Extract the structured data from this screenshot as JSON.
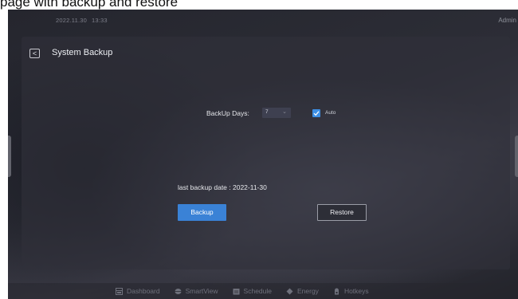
{
  "caption": "page with backup and restore",
  "topbar": {
    "date": "2022.11.30",
    "time": "13:33",
    "user": "Admin"
  },
  "page": {
    "back_icon": "chevron-left-icon",
    "title": "System Backup"
  },
  "backup_settings": {
    "days_label": "BackUp Days:",
    "days_value": "7",
    "auto_checked": true,
    "auto_label": "Auto"
  },
  "status": {
    "last_backup_text": "last backup date : 2022-11-30"
  },
  "actions": {
    "backup_label": "Backup",
    "restore_label": "Restore"
  },
  "nav": {
    "items": [
      {
        "label": "Dashboard",
        "icon": "dashboard-icon"
      },
      {
        "label": "SmartView",
        "icon": "smartview-icon"
      },
      {
        "label": "Schedule",
        "icon": "schedule-icon"
      },
      {
        "label": "Energy",
        "icon": "energy-icon"
      },
      {
        "label": "Hotkeys",
        "icon": "hotkeys-icon"
      }
    ]
  },
  "colors": {
    "accent": "#3a82d6",
    "checkbox": "#3d8fe5"
  }
}
